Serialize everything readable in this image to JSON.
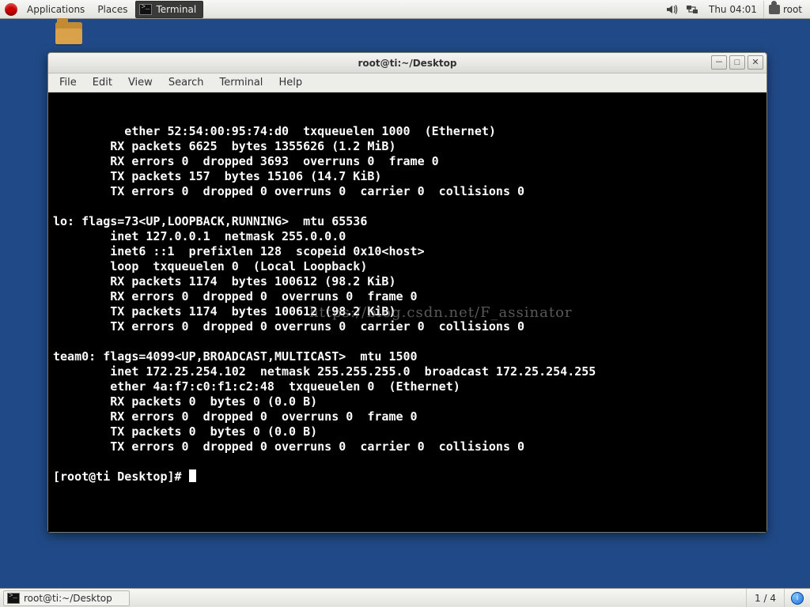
{
  "top_panel": {
    "applications": "Applications",
    "places": "Places",
    "task_label": "Terminal",
    "clock": "Thu 04:01",
    "user": "root"
  },
  "bottom_panel": {
    "task_label": "root@ti:~/Desktop",
    "workspace": "1 / 4"
  },
  "window": {
    "title": "root@ti:~/Desktop",
    "menus": [
      "File",
      "Edit",
      "View",
      "Search",
      "Terminal",
      "Help"
    ]
  },
  "terminal_lines": [
    "        ether 52:54:00:95:74:d0  txqueuelen 1000  (Ethernet)",
    "        RX packets 6625  bytes 1355626 (1.2 MiB)",
    "        RX errors 0  dropped 3693  overruns 0  frame 0",
    "        TX packets 157  bytes 15106 (14.7 KiB)",
    "        TX errors 0  dropped 0 overruns 0  carrier 0  collisions 0",
    "",
    "lo: flags=73<UP,LOOPBACK,RUNNING>  mtu 65536",
    "        inet 127.0.0.1  netmask 255.0.0.0",
    "        inet6 ::1  prefixlen 128  scopeid 0x10<host>",
    "        loop  txqueuelen 0  (Local Loopback)",
    "        RX packets 1174  bytes 100612 (98.2 KiB)",
    "        RX errors 0  dropped 0  overruns 0  frame 0",
    "        TX packets 1174  bytes 100612 (98.2 KiB)",
    "        TX errors 0  dropped 0 overruns 0  carrier 0  collisions 0",
    "",
    "team0: flags=4099<UP,BROADCAST,MULTICAST>  mtu 1500",
    "        inet 172.25.254.102  netmask 255.255.255.0  broadcast 172.25.254.255",
    "        ether 4a:f7:c0:f1:c2:48  txqueuelen 0  (Ethernet)",
    "        RX packets 0  bytes 0 (0.0 B)",
    "        RX errors 0  dropped 0  overruns 0  frame 0",
    "        TX packets 0  bytes 0 (0.0 B)",
    "        TX errors 0  dropped 0 overruns 0  carrier 0  collisions 0",
    ""
  ],
  "prompt": "[root@ti Desktop]# ",
  "watermark": "https://blog.csdn.net/F_assinator"
}
